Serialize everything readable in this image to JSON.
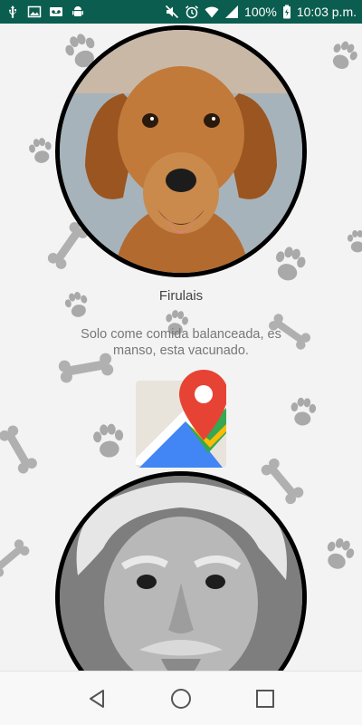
{
  "status_bar": {
    "battery_percent": "100%",
    "time": "10:03 p.m.",
    "left_icons": [
      "usb-icon",
      "image-icon",
      "voicemail-icon",
      "android-icon"
    ],
    "right_icons": [
      "mute-icon",
      "alarm-icon",
      "wifi-icon",
      "signal-icon",
      "battery-icon"
    ]
  },
  "pet": {
    "name": "Firulais",
    "description": "Solo come comida balanceada, es manso, esta vacunado."
  },
  "colors": {
    "status_bar": "#0b5d4f",
    "background": "#f3f3f3",
    "avatar_border": "#000000",
    "map_red": "#e74335",
    "map_blue": "#4285f4",
    "map_green": "#34a853",
    "map_yellow": "#fbbc04"
  },
  "nav": {
    "icons": [
      "back-icon",
      "home-icon",
      "recents-icon"
    ]
  }
}
